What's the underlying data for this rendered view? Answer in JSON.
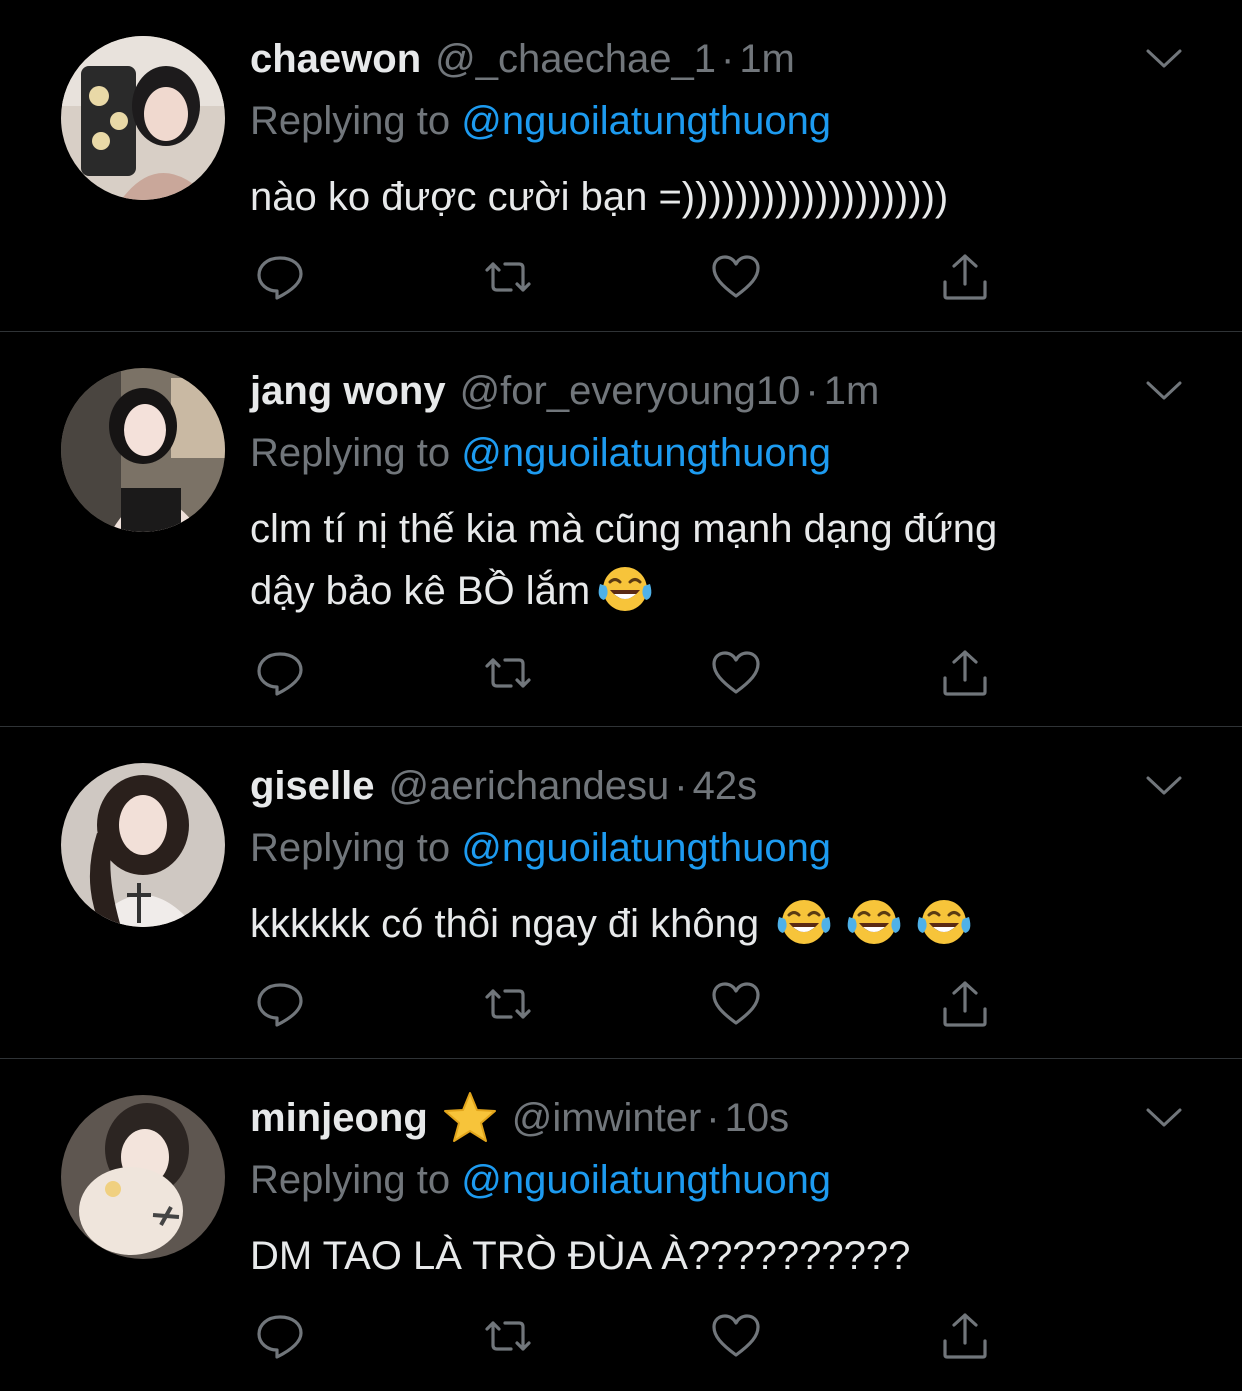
{
  "replying_label": "Replying to",
  "colors": {
    "background": "#000000",
    "accent": "#1d9bf0",
    "muted": "#71767b",
    "text": "#e7e9ea"
  },
  "tweets": [
    {
      "name": "chaewon",
      "handle": "@_chaechae_1",
      "time": "1m",
      "reply_to": "@nguoilatungthuong",
      "lines": [
        "nào ko được cười bạn =))))))))))))))))))))"
      ],
      "emojis_after": 0,
      "verified_star": false,
      "avatar": "avatar-photo"
    },
    {
      "name": "jang wony",
      "handle": "@for_everyoung10",
      "time": "1m",
      "reply_to": "@nguoilatungthuong",
      "lines": [
        "clm tí nị thế kia mà cũng mạnh dạng đứng",
        "dậy bảo kê BỒ lắm"
      ],
      "emojis_after": 1,
      "verified_star": false,
      "avatar": "avatar-photo"
    },
    {
      "name": "giselle",
      "handle": "@aerichandesu",
      "time": "42s",
      "reply_to": "@nguoilatungthuong",
      "lines": [
        "kkkkkk có thôi ngay đi không"
      ],
      "emojis_after": 3,
      "verified_star": false,
      "avatar": "avatar-photo"
    },
    {
      "name": "minjeong",
      "handle": "@imwinter",
      "time": "10s",
      "reply_to": "@nguoilatungthuong",
      "lines": [
        "DM TAO LÀ TRÒ ĐÙA À??????????"
      ],
      "emojis_after": 0,
      "verified_star": true,
      "avatar": "avatar-photo"
    }
  ],
  "icons": {
    "reply": "reply-icon",
    "retweet": "retweet-icon",
    "like": "heart-icon",
    "share": "share-icon",
    "more": "chevron-down-icon",
    "emoji": "tears-of-joy-emoji",
    "star": "star-emoji"
  }
}
